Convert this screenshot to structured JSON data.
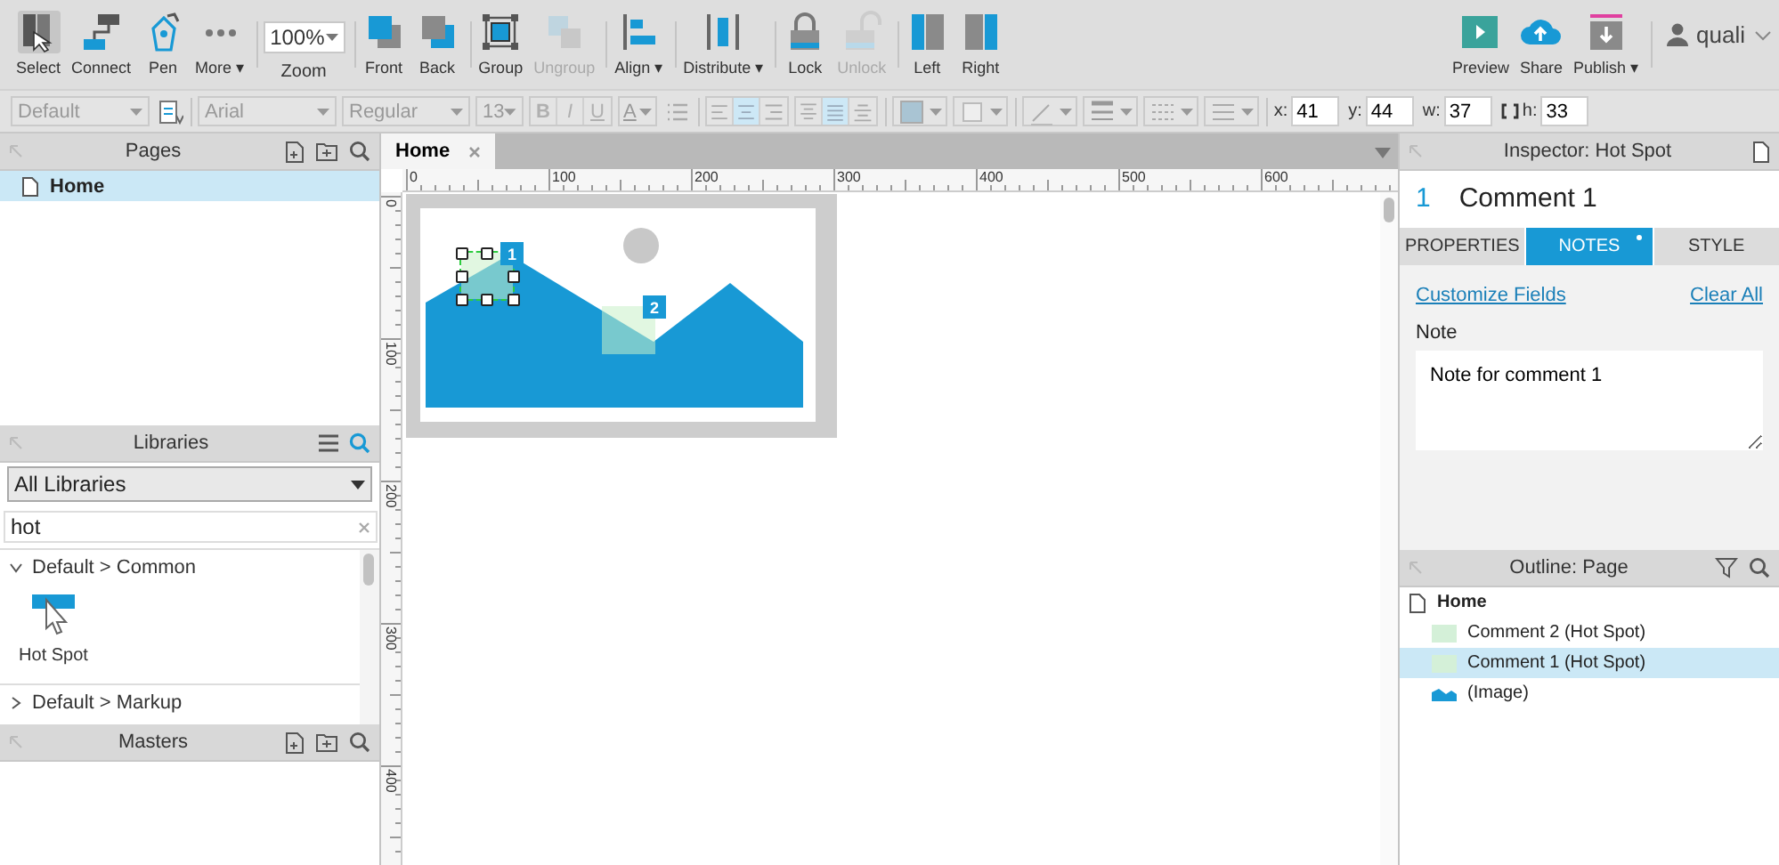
{
  "toolbar": {
    "groups": [
      [
        {
          "kind": "button",
          "label": "Select",
          "selected": true,
          "disabled": false
        },
        {
          "kind": "button",
          "label": "Connect",
          "selected": false,
          "disabled": false
        },
        {
          "kind": "button",
          "label": "Pen",
          "selected": false,
          "disabled": false
        },
        {
          "kind": "button",
          "label": "More ▾",
          "selected": false,
          "disabled": false
        }
      ],
      [
        {
          "kind": "zoom",
          "label": "Zoom",
          "value": "100%"
        }
      ],
      [
        {
          "kind": "button",
          "label": "Front",
          "selected": false,
          "disabled": false
        },
        {
          "kind": "button",
          "label": "Back",
          "selected": false,
          "disabled": false
        }
      ],
      [
        {
          "kind": "button",
          "label": "Group",
          "selected": false,
          "disabled": false
        },
        {
          "kind": "button",
          "label": "Ungroup",
          "selected": false,
          "disabled": true
        }
      ],
      [
        {
          "kind": "button",
          "label": "Align ▾",
          "selected": false,
          "disabled": false
        }
      ],
      [
        {
          "kind": "button",
          "label": "Distribute ▾",
          "selected": false,
          "disabled": false
        }
      ],
      [
        {
          "kind": "button",
          "label": "Lock",
          "selected": false,
          "disabled": false
        },
        {
          "kind": "button",
          "label": "Unlock",
          "selected": false,
          "disabled": true
        }
      ],
      [
        {
          "kind": "button",
          "label": "Left",
          "selected": false,
          "disabled": false
        },
        {
          "kind": "button",
          "label": "Right",
          "selected": false,
          "disabled": false
        }
      ]
    ],
    "publish_tools": [
      {
        "kind": "button",
        "label": "Preview",
        "selected": false,
        "disabled": false
      },
      {
        "kind": "button",
        "label": "Share",
        "selected": false,
        "disabled": false
      },
      {
        "kind": "button",
        "label": "Publish ▾",
        "selected": false,
        "disabled": false
      }
    ],
    "user": {
      "name": "quali"
    }
  },
  "format_bar": {
    "groups": [
      [
        {
          "kind": "dropdown",
          "value": "Default",
          "disabled": true
        },
        {
          "kind": "icon"
        }
      ],
      [
        {
          "kind": "dropdown",
          "value": "Arial",
          "disabled": true
        },
        {
          "kind": "dropdown",
          "value": "Regular",
          "disabled": true
        },
        {
          "kind": "dropdown",
          "value": "13",
          "disabled": true
        },
        {
          "kind": "text-segment",
          "buttons": [
            {
              "text": "B",
              "disabled": true
            },
            {
              "text": "I",
              "disabled": true
            },
            {
              "text": "U",
              "disabled": true
            }
          ]
        },
        {
          "kind": "text-picker",
          "text": "A",
          "disabled": true
        },
        {
          "kind": "icon"
        }
      ],
      [
        {
          "kind": "icon-segment",
          "buttons": [
            {
              "selected": false
            },
            {
              "selected": true
            },
            {
              "selected": false
            }
          ]
        },
        {
          "kind": "icon-segment",
          "buttons": [
            {
              "selected": false
            },
            {
              "selected": true
            },
            {
              "selected": false
            }
          ]
        }
      ],
      [
        {
          "kind": "icon-picker"
        },
        {
          "kind": "icon-picker"
        }
      ],
      [
        {
          "kind": "icon-picker"
        },
        {
          "kind": "icon-picker"
        },
        {
          "kind": "icon-picker"
        },
        {
          "kind": "icon-picker"
        }
      ],
      [
        {
          "kind": "coord",
          "label": "x:",
          "value": "41"
        },
        {
          "kind": "coord",
          "label": "y:",
          "value": "44"
        },
        {
          "kind": "coord",
          "label": "w:",
          "value": "37"
        },
        {
          "kind": "coord",
          "label": "h:",
          "value": "33",
          "constrain_icon": true
        }
      ]
    ]
  },
  "pages": {
    "title": "Pages",
    "items": [
      {
        "label": "Home",
        "selected": true
      }
    ]
  },
  "libraries": {
    "title": "Libraries",
    "library_select": "All Libraries",
    "search": {
      "value": "hot"
    },
    "groups": [
      {
        "label": "Default > Common",
        "expanded": true,
        "widgets": [
          {
            "label": "Hot Spot"
          }
        ]
      },
      {
        "label": "Default > Markup",
        "expanded": false
      }
    ]
  },
  "masters": {
    "title": "Masters"
  },
  "tabs": [
    {
      "label": "Home",
      "selected": true
    }
  ],
  "ruler": {
    "x_labels": [
      "0",
      "100",
      "200",
      "300",
      "400",
      "500",
      "600"
    ],
    "y_labels": [
      "0",
      "100",
      "200",
      "300",
      "400"
    ]
  },
  "canvas": {
    "hotspots": [
      {
        "number": "1",
        "selected": true
      },
      {
        "number": "2",
        "selected": false
      }
    ]
  },
  "inspector": {
    "title": "Inspector: Hot Spot",
    "number": "1",
    "name": "Comment 1",
    "tabs": [
      {
        "label": "PROPERTIES",
        "selected": false,
        "modified": false
      },
      {
        "label": "NOTES",
        "selected": true,
        "modified": true
      },
      {
        "label": "STYLE",
        "selected": false,
        "modified": false
      }
    ],
    "links": [
      "Customize Fields",
      "Clear All"
    ],
    "note_label": "Note",
    "note_value": "Note for comment 1"
  },
  "outline": {
    "title": "Outline: Page",
    "items": [
      {
        "label": "Home",
        "kind": "page",
        "selected": false,
        "children": [
          {
            "label": "Comment 2 (Hot Spot)",
            "kind": "hotspot",
            "selected": false
          },
          {
            "label": "Comment 1 (Hot Spot)",
            "kind": "hotspot",
            "selected": true
          },
          {
            "label": "(Image)",
            "kind": "image",
            "selected": false
          }
        ]
      }
    ]
  }
}
